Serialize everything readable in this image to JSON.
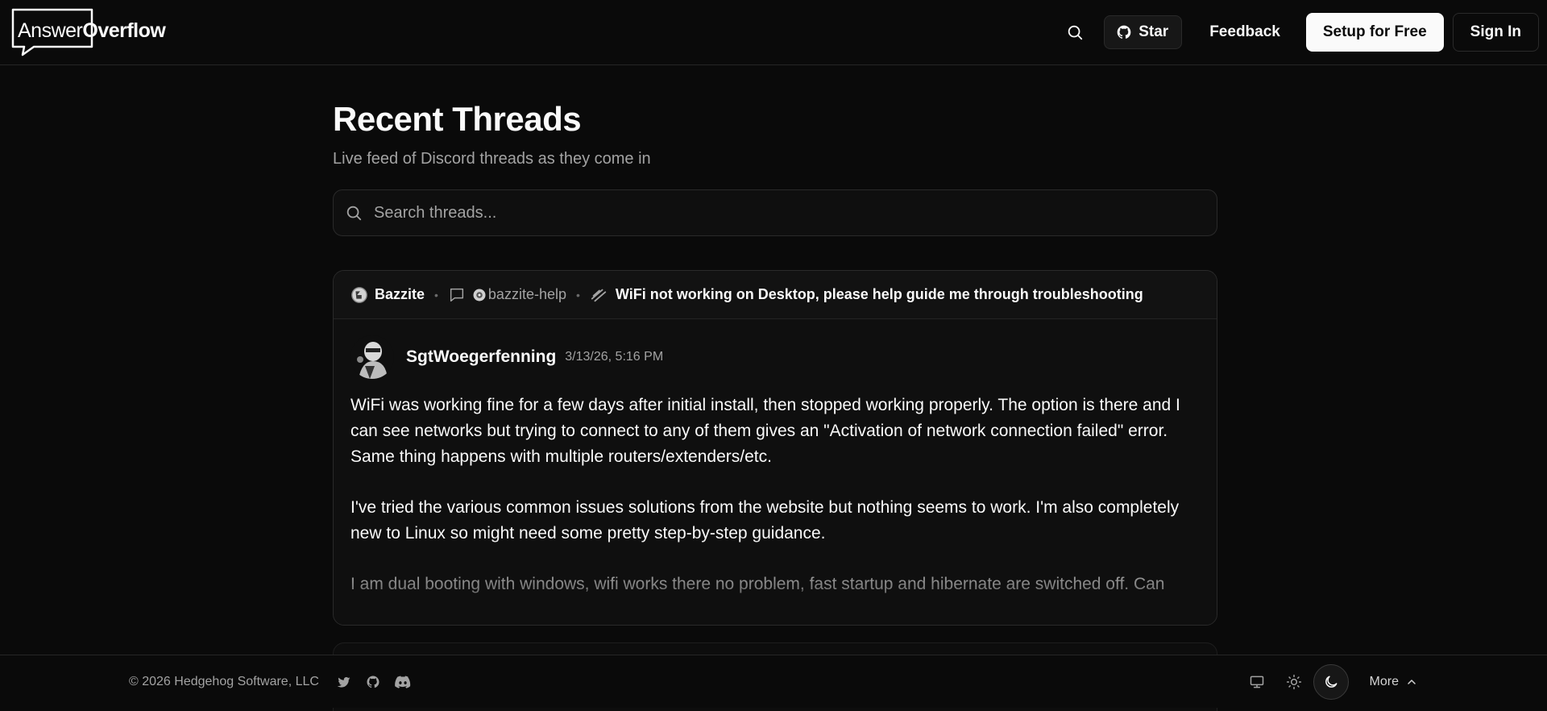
{
  "header": {
    "logo": {
      "answer": "Answer",
      "overflow": "Overflow"
    },
    "star_label": "Star",
    "feedback_label": "Feedback",
    "setup_label": "Setup for Free",
    "signin_label": "Sign In"
  },
  "main": {
    "title": "Recent Threads",
    "subtitle": "Live feed of Discord threads as they come in",
    "search_placeholder": "Search threads...",
    "thread": {
      "server": "Bazzite",
      "channel": "bazzite-help",
      "title": "WiFi not working on Desktop, please help guide me through troubleshooting",
      "author": "SgtWoegerfenning",
      "timestamp": "3/13/26, 5:16 PM",
      "paragraphs": [
        "WiFi was working fine for a few days after initial install, then stopped working properly. The option is there and I can see networks but trying to connect to any of them gives an \"Activation of network connection failed\" error. Same thing happens with multiple routers/extenders/etc.",
        "I've tried the various common issues solutions from the website but nothing seems to work. I'm also completely new to Linux so might need some pretty step-by-step guidance.",
        "I am dual booting with windows, wifi works there no problem, fast startup and hibernate are switched off. Can"
      ]
    }
  },
  "footer": {
    "copyright": "© 2026 Hedgehog Software, LLC",
    "more_label": "More"
  },
  "icons": [
    "search-icon",
    "github-icon",
    "message-square-icon",
    "twitter-icon",
    "discord-icon",
    "monitor-icon",
    "sun-icon",
    "moon-icon",
    "chevron-up-icon"
  ]
}
